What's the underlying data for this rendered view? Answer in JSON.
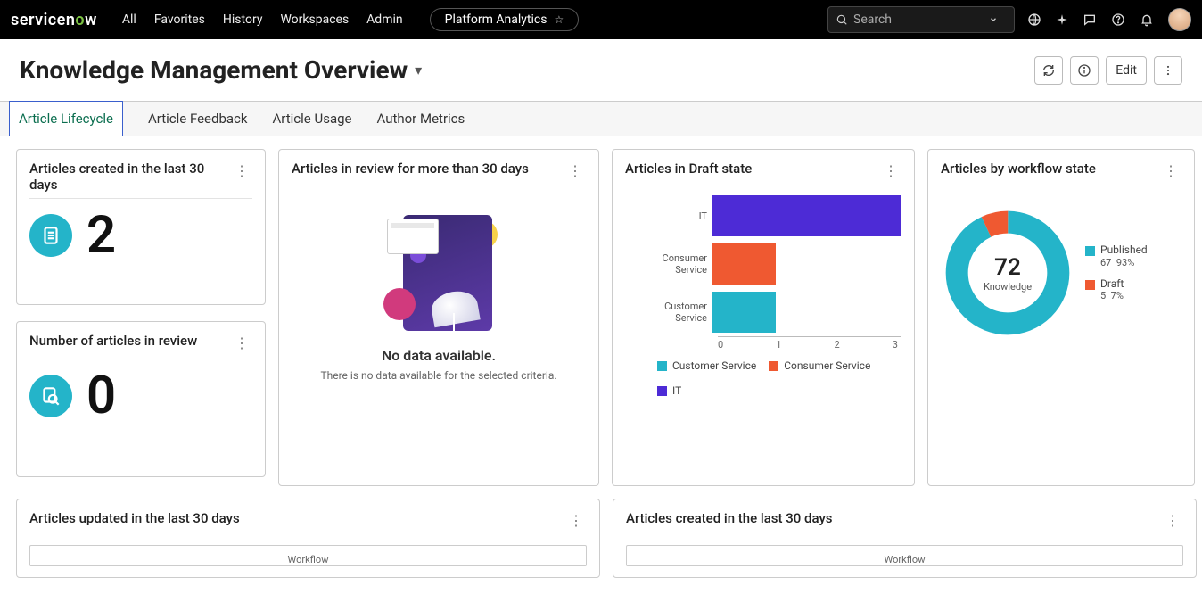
{
  "header": {
    "logo_text": "servicenow",
    "nav": {
      "all": "All",
      "favorites": "Favorites",
      "history": "History",
      "workspaces": "Workspaces",
      "admin": "Admin"
    },
    "chip": "Platform Analytics",
    "search_placeholder": "Search"
  },
  "page": {
    "title": "Knowledge Management Overview",
    "actions": {
      "edit": "Edit"
    }
  },
  "tabs": {
    "t0": "Article Lifecycle",
    "t1": "Article Feedback",
    "t2": "Article Usage",
    "t3": "Author Metrics"
  },
  "cards": {
    "created30": {
      "title": "Articles created in the last 30 days",
      "value": "2"
    },
    "review_count": {
      "title": "Number of articles in review",
      "value": "0"
    },
    "review30": {
      "title": "Articles in review for more than 30 days",
      "nd_title": "No data available.",
      "nd_sub": "There is no data available for the selected criteria."
    },
    "draft": {
      "title": "Articles in Draft state"
    },
    "byworkflow": {
      "title": "Articles by workflow state"
    },
    "updated30": {
      "title": "Articles updated in the last 30 days",
      "sub": "Workflow"
    },
    "created30b": {
      "title": "Articles created in the last 30 days",
      "sub": "Workflow"
    }
  },
  "chart_data": {
    "draft_bar": {
      "type": "bar",
      "categories": [
        "IT",
        "Consumer Service",
        "Customer Service"
      ],
      "values": [
        3,
        1,
        1
      ],
      "colors": [
        "#4d2bd6",
        "#ef5931",
        "#24b4c9"
      ],
      "xlim": [
        0,
        3
      ],
      "xticks": [
        0,
        1,
        2,
        3
      ],
      "legend": [
        {
          "label": "Customer Service",
          "color": "#24b4c9"
        },
        {
          "label": "Consumer Service",
          "color": "#ef5931"
        },
        {
          "label": "IT",
          "color": "#4d2bd6"
        }
      ]
    },
    "workflow_donut": {
      "type": "pie",
      "total": 72,
      "total_label": "Knowledge",
      "series": [
        {
          "name": "Published",
          "value": 67,
          "pct": "93%",
          "color": "#24b4c9"
        },
        {
          "name": "Draft",
          "value": 5,
          "pct": "7%",
          "color": "#ef5931"
        }
      ]
    }
  },
  "colors": {
    "accent": "#24b4c9",
    "purple": "#4d2bd6",
    "orange": "#ef5931"
  }
}
